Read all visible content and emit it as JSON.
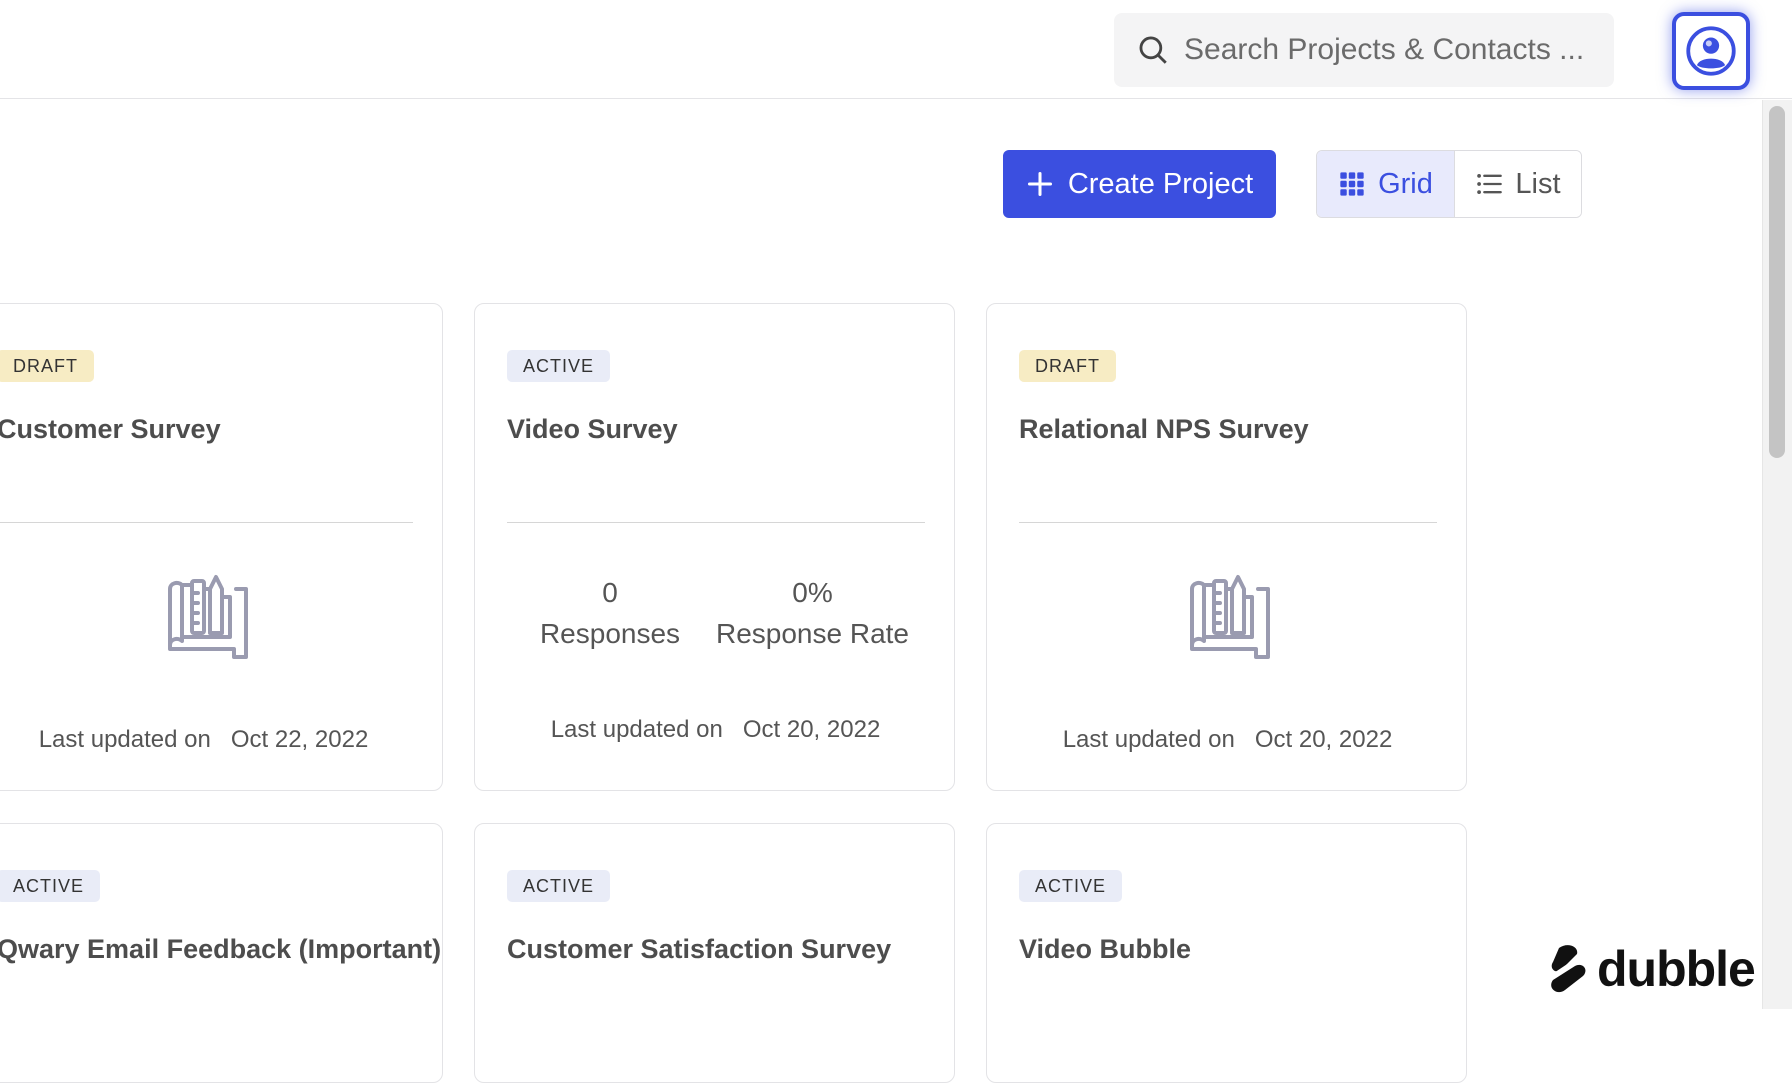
{
  "header": {
    "search_placeholder": "Search Projects & Contacts ..."
  },
  "toolbar": {
    "create_label": "Create Project",
    "view_grid_label": "Grid",
    "view_list_label": "List",
    "active_view": "Grid"
  },
  "labels": {
    "last_updated_prefix": "Last updated on",
    "responses_label": "Responses",
    "response_rate_label": "Response Rate"
  },
  "cards": [
    {
      "status": "DRAFT",
      "title": "Customer Survey",
      "updated": "Oct 22, 2022"
    },
    {
      "status": "ACTIVE",
      "title": "Video Survey",
      "responses": "0",
      "response_rate": "0%",
      "updated": "Oct 20, 2022"
    },
    {
      "status": "DRAFT",
      "title": "Relational NPS Survey",
      "updated": "Oct 20, 2022"
    },
    {
      "status": "ACTIVE",
      "title": "Qwary Email Feedback (Important)"
    },
    {
      "status": "ACTIVE",
      "title": "Customer Satisfaction Survey"
    },
    {
      "status": "ACTIVE",
      "title": "Video Bubble"
    }
  ],
  "brand": {
    "name": "dubble"
  },
  "colors": {
    "accent": "#3b4fe0",
    "draft_badge": "#f7ecc4",
    "active_badge": "#e9ecf7"
  }
}
